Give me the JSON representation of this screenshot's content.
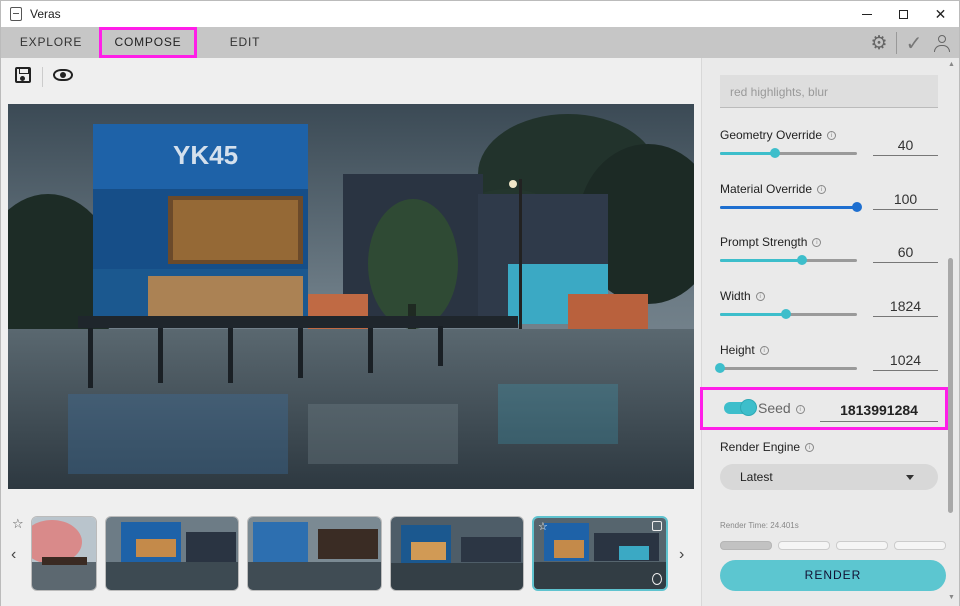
{
  "window": {
    "title": "Veras",
    "minimize": "",
    "maximize": "",
    "close": "✕"
  },
  "tabs": [
    {
      "label": "EXPLORE"
    },
    {
      "label": "COMPOSE",
      "selected": true
    },
    {
      "label": "EDIT"
    }
  ],
  "header_icons": [
    "gear-icon",
    "check-icon",
    "user-icon"
  ],
  "toolbar": {
    "icons": [
      "save-icon",
      "eye-icon"
    ]
  },
  "thumbnails": {
    "count": 5,
    "selected_index": 4
  },
  "panel": {
    "prompt": {
      "placeholder": "red highlights, blur"
    },
    "params": [
      {
        "label": "Geometry Override",
        "value": "40",
        "fraction": 0.4,
        "color": "#3dbecb"
      },
      {
        "label": "Material Override",
        "value": "100",
        "fraction": 1.0,
        "color": "#1e6fd0"
      },
      {
        "label": "Prompt Strength",
        "value": "60",
        "fraction": 0.6,
        "color": "#3dbecb"
      },
      {
        "label": "Width",
        "value": "1824",
        "fraction": 0.48,
        "color": "#3dbecb"
      },
      {
        "label": "Height",
        "value": "1024",
        "fraction": 0.0,
        "color": "#3dbecb"
      }
    ],
    "seed": {
      "label": "Seed",
      "value": "1813991284",
      "enabled": true
    },
    "render_engine": {
      "label": "Render Engine",
      "selected": "Latest"
    },
    "render_time": "Render Time: 24.401s",
    "progress": {
      "segments": 4,
      "completed": 1
    },
    "render_button": "RENDER"
  },
  "colors": {
    "accent": "#5cc6d0",
    "highlight": "#ff1ee8",
    "material_slider": "#1e6fd0"
  }
}
